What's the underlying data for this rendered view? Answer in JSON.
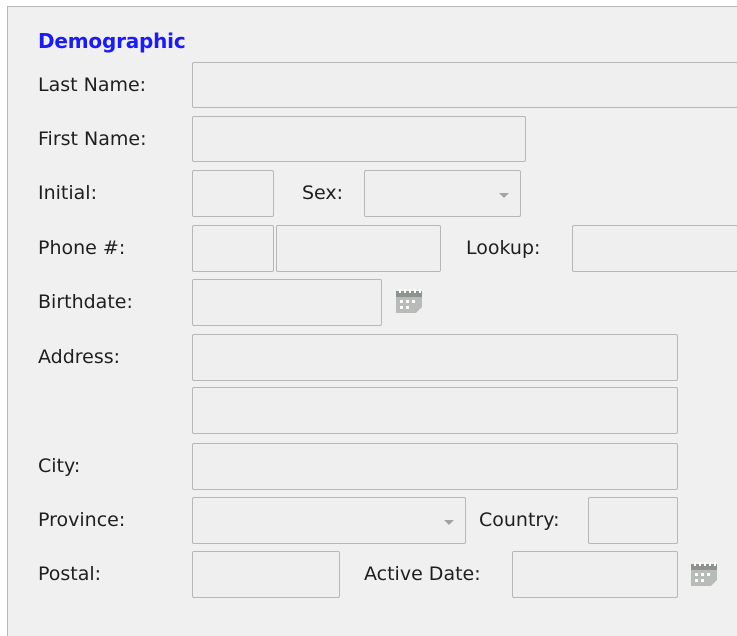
{
  "section": {
    "title": "Demographic"
  },
  "labels": {
    "last_name": "Last Name:",
    "first_name": "First Name:",
    "initial": "Initial:",
    "sex": "Sex:",
    "phone": "Phone #:",
    "lookup": "Lookup:",
    "birthdate": "Birthdate:",
    "address": "Address:",
    "city": "City:",
    "province": "Province:",
    "country": "Country:",
    "postal": "Postal:",
    "active_date": "Active Date:"
  },
  "fields": {
    "last_name": "",
    "first_name": "",
    "initial": "",
    "sex": "",
    "phone_area": "",
    "phone_number": "",
    "lookup": "",
    "birthdate": "",
    "address_line1": "",
    "address_line2": "",
    "city": "",
    "province": "",
    "country": "",
    "postal": "",
    "active_date": ""
  },
  "icons": {
    "calendar": "calendar-icon",
    "dropdown": "chevron-down-icon"
  },
  "colors": {
    "title": "#1a1aff",
    "panel_bg": "#f0f0f0",
    "field_bg": "#efefef",
    "field_border": "#b7b7b7"
  }
}
